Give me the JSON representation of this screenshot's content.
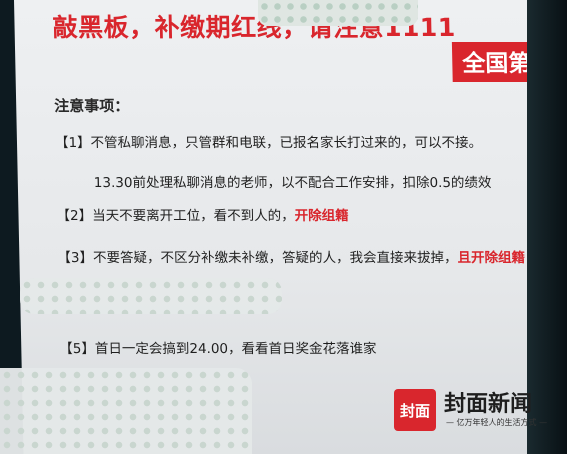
{
  "header": {
    "title": "敲黑板，补缴期红线，请注意1111",
    "badge": "全国第一"
  },
  "notice": {
    "heading": "注意事项：",
    "items": [
      {
        "num": "【1】",
        "text": "不管私聊消息，只管群和电联，已报名家长打过来的，可以不接。"
      },
      {
        "num": "",
        "text": "13.30前处理私聊消息的老师，以不配合工作安排，扣除0.5的绩效"
      },
      {
        "num": "【2】",
        "text": "当天不要离开工位，看不到人的，",
        "highlight": "开除组籍"
      },
      {
        "num": "【3】",
        "text": "不要答疑，不区分补缴未补缴，答疑的人，我会直接来拔掉，",
        "highlight": "且开除组籍"
      },
      {
        "num": "【5】",
        "text": "首日一定会搞到24.00，看看首日奖金花落谁家"
      }
    ]
  },
  "watermark": {
    "logo_char": "封面",
    "name": "封面新闻",
    "slogan": "— 亿万年轻人的生活方式 —"
  }
}
